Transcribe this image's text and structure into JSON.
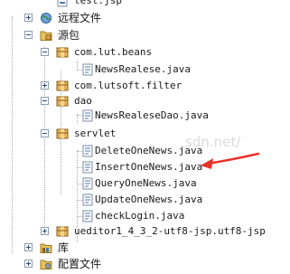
{
  "project_tree": {
    "items": [
      {
        "label": "test.jsp",
        "icon": "jsp-file-icon"
      },
      {
        "label": "远程文件",
        "icon": "remote-globe-icon"
      },
      {
        "label": "源包",
        "icon": "folder-icon"
      },
      {
        "label": "com.lut.beans",
        "icon": "package-icon"
      },
      {
        "label": "NewsRealese.java",
        "icon": "java-file-icon"
      },
      {
        "label": "com.lutsoft.filter",
        "icon": "package-icon"
      },
      {
        "label": "dao",
        "icon": "package-icon"
      },
      {
        "label": "NewsRealeseDao.java",
        "icon": "java-file-icon"
      },
      {
        "label": "servlet",
        "icon": "package-icon"
      },
      {
        "label": "DeleteOneNews.java",
        "icon": "java-file-icon"
      },
      {
        "label": "InsertOneNews.java",
        "icon": "java-file-icon"
      },
      {
        "label": "QueryOneNews.java",
        "icon": "java-file-icon"
      },
      {
        "label": "UpdateOneNews.java",
        "icon": "java-file-icon"
      },
      {
        "label": "checkLogin.java",
        "icon": "java-file-icon"
      },
      {
        "label": "ueditor1_4_3_2-utf8-jsp.utf8-jsp",
        "icon": "package-icon"
      },
      {
        "label": "库",
        "icon": "library-icon"
      },
      {
        "label": "配置文件",
        "icon": "config-folder-icon"
      }
    ]
  },
  "watermark": "sdn.net/",
  "annotation": {
    "color": "#e8312b"
  },
  "colors": {
    "package": "#d9a64a",
    "folder": "#e8c35a",
    "java_file": "#4a78b0"
  }
}
